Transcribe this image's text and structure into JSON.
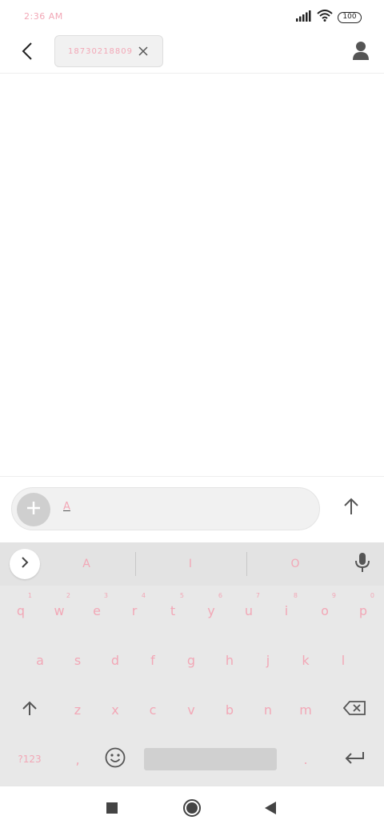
{
  "status_bar": {
    "time": "2:36 AM",
    "battery": "100",
    "icons": [
      "signal-icon",
      "wifi-icon",
      "battery-icon"
    ]
  },
  "header": {
    "back_icon": "chevron-left-icon",
    "recipient": "18730218809",
    "chip_close_icon": "close-icon",
    "contact_icon": "person-icon"
  },
  "composer": {
    "attach_icon": "plus-icon",
    "input_value": "A",
    "send_icon": "arrow-up-icon"
  },
  "keyboard": {
    "suggestions": [
      "A",
      "I",
      "O"
    ],
    "expand_icon": "chevron-right-icon",
    "mic_icon": "mic-icon",
    "row1": [
      {
        "key": "q",
        "hint": "1"
      },
      {
        "key": "w",
        "hint": "2"
      },
      {
        "key": "e",
        "hint": "3"
      },
      {
        "key": "r",
        "hint": "4"
      },
      {
        "key": "t",
        "hint": "5"
      },
      {
        "key": "y",
        "hint": "6"
      },
      {
        "key": "u",
        "hint": "7"
      },
      {
        "key": "i",
        "hint": "8"
      },
      {
        "key": "o",
        "hint": "9"
      },
      {
        "key": "p",
        "hint": "0"
      }
    ],
    "row2": [
      "a",
      "s",
      "d",
      "f",
      "g",
      "h",
      "j",
      "k",
      "l"
    ],
    "row3": [
      "z",
      "x",
      "c",
      "v",
      "b",
      "n",
      "m"
    ],
    "shift_icon": "shift-icon",
    "backspace_icon": "backspace-icon",
    "symbols_label": "?123",
    "comma": ",",
    "emoji_icon": "emoji-icon",
    "period": ".",
    "enter_icon": "enter-icon"
  },
  "nav": {
    "icons": [
      "recents-square-icon",
      "home-circle-icon",
      "back-triangle-icon"
    ]
  },
  "colors": {
    "accent_text": "#f2a7b6",
    "keyboard_bg": "#e8e8e8",
    "icon_gray": "#555555"
  }
}
